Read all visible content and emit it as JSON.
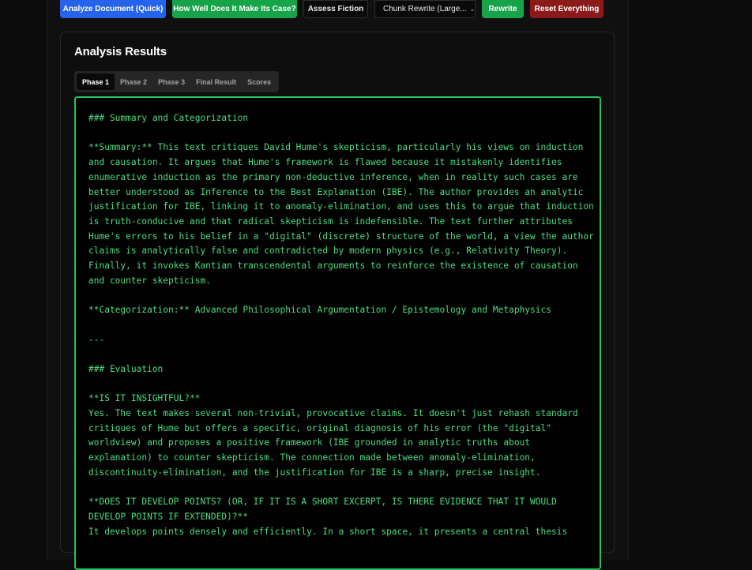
{
  "toolbar": {
    "analyze_quick": "Analyze Document (Quick)",
    "make_case": "How Well Does It Make Its Case?",
    "assess_fiction": "Assess Fiction",
    "chunk_rewrite": "Chunk Rewrite (Large...",
    "rewrite": "Rewrite",
    "reset": "Reset Everything"
  },
  "results": {
    "title": "Analysis Results",
    "tabs": [
      "Phase 1",
      "Phase 2",
      "Phase 3",
      "Final Result",
      "Scores"
    ],
    "active_tab": "Phase 1",
    "lines": [
      "### Summary and Categorization",
      "",
      "**Summary:** This text critiques David Hume's skepticism, particularly his views on induction",
      "and causation. It argues that Hume's framework is flawed because it mistakenly identifies",
      "enumerative induction as the primary non-deductive inference, when in reality such cases are",
      "better understood as Inference to the Best Explanation (IBE). The author provides an analytic",
      "justification for IBE, linking it to anomaly-elimination, and uses this to argue that induction",
      "is truth-conducive and that radical skepticism is indefensible. The text further attributes",
      "Hume's errors to his belief in a \"digital\" (discrete) structure of the world, a view the author",
      "claims is analytically false and contradicted by modern physics (e.g., Relativity Theory).",
      "Finally, it invokes Kantian transcendental arguments to reinforce the existence of causation",
      "and counter skepticism.",
      "",
      "**Categorization:** Advanced Philosophical Argumentation / Epistemology and Metaphysics",
      "",
      "---",
      "",
      "### Evaluation",
      "",
      "**IS IT INSIGHTFUL?**",
      "Yes. The text makes several non-trivial, provocative claims. It doesn't just rehash standard",
      "critiques of Hume but offers a specific, original diagnosis of his error (the \"digital\"",
      "worldview) and proposes a positive framework (IBE grounded in analytic truths about",
      "explanation) to counter skepticism. The connection made between anomaly-elimination,",
      "discontinuity-elimination, and the justification for IBE is a sharp, precise insight.",
      "",
      "**DOES IT DEVELOP POINTS? (OR, IF IT IS A SHORT EXCERPT, IS THERE EVIDENCE THAT IT WOULD",
      "DEVELOP POINTS IF EXTENDED)?**",
      "It develops points densely and efficiently. In a short space, it presents a central thesis"
    ]
  }
}
